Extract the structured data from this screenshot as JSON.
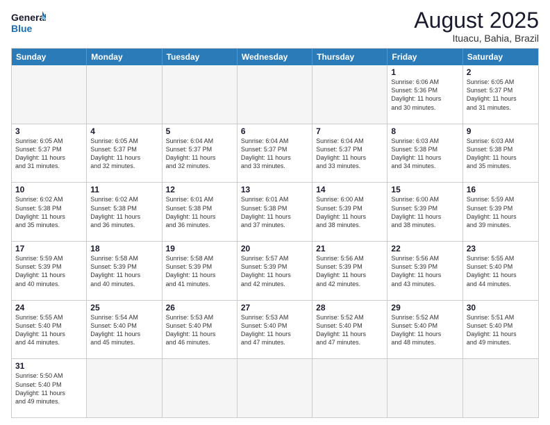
{
  "header": {
    "logo_general": "General",
    "logo_blue": "Blue",
    "main_title": "August 2025",
    "subtitle": "Ituacu, Bahia, Brazil"
  },
  "days_of_week": [
    "Sunday",
    "Monday",
    "Tuesday",
    "Wednesday",
    "Thursday",
    "Friday",
    "Saturday"
  ],
  "weeks": [
    [
      {
        "day": "",
        "sunrise": "",
        "sunset": "",
        "daylight": ""
      },
      {
        "day": "",
        "sunrise": "",
        "sunset": "",
        "daylight": ""
      },
      {
        "day": "",
        "sunrise": "",
        "sunset": "",
        "daylight": ""
      },
      {
        "day": "",
        "sunrise": "",
        "sunset": "",
        "daylight": ""
      },
      {
        "day": "",
        "sunrise": "",
        "sunset": "",
        "daylight": ""
      },
      {
        "day": "1",
        "sunrise": "Sunrise: 6:06 AM",
        "sunset": "Sunset: 5:36 PM",
        "daylight": "Daylight: 11 hours",
        "daylight2": "and 30 minutes."
      },
      {
        "day": "2",
        "sunrise": "Sunrise: 6:05 AM",
        "sunset": "Sunset: 5:37 PM",
        "daylight": "Daylight: 11 hours",
        "daylight2": "and 31 minutes."
      }
    ],
    [
      {
        "day": "3",
        "sunrise": "Sunrise: 6:05 AM",
        "sunset": "Sunset: 5:37 PM",
        "daylight": "Daylight: 11 hours",
        "daylight2": "and 31 minutes."
      },
      {
        "day": "4",
        "sunrise": "Sunrise: 6:05 AM",
        "sunset": "Sunset: 5:37 PM",
        "daylight": "Daylight: 11 hours",
        "daylight2": "and 32 minutes."
      },
      {
        "day": "5",
        "sunrise": "Sunrise: 6:04 AM",
        "sunset": "Sunset: 5:37 PM",
        "daylight": "Daylight: 11 hours",
        "daylight2": "and 32 minutes."
      },
      {
        "day": "6",
        "sunrise": "Sunrise: 6:04 AM",
        "sunset": "Sunset: 5:37 PM",
        "daylight": "Daylight: 11 hours",
        "daylight2": "and 33 minutes."
      },
      {
        "day": "7",
        "sunrise": "Sunrise: 6:04 AM",
        "sunset": "Sunset: 5:37 PM",
        "daylight": "Daylight: 11 hours",
        "daylight2": "and 33 minutes."
      },
      {
        "day": "8",
        "sunrise": "Sunrise: 6:03 AM",
        "sunset": "Sunset: 5:38 PM",
        "daylight": "Daylight: 11 hours",
        "daylight2": "and 34 minutes."
      },
      {
        "day": "9",
        "sunrise": "Sunrise: 6:03 AM",
        "sunset": "Sunset: 5:38 PM",
        "daylight": "Daylight: 11 hours",
        "daylight2": "and 35 minutes."
      }
    ],
    [
      {
        "day": "10",
        "sunrise": "Sunrise: 6:02 AM",
        "sunset": "Sunset: 5:38 PM",
        "daylight": "Daylight: 11 hours",
        "daylight2": "and 35 minutes."
      },
      {
        "day": "11",
        "sunrise": "Sunrise: 6:02 AM",
        "sunset": "Sunset: 5:38 PM",
        "daylight": "Daylight: 11 hours",
        "daylight2": "and 36 minutes."
      },
      {
        "day": "12",
        "sunrise": "Sunrise: 6:01 AM",
        "sunset": "Sunset: 5:38 PM",
        "daylight": "Daylight: 11 hours",
        "daylight2": "and 36 minutes."
      },
      {
        "day": "13",
        "sunrise": "Sunrise: 6:01 AM",
        "sunset": "Sunset: 5:38 PM",
        "daylight": "Daylight: 11 hours",
        "daylight2": "and 37 minutes."
      },
      {
        "day": "14",
        "sunrise": "Sunrise: 6:00 AM",
        "sunset": "Sunset: 5:39 PM",
        "daylight": "Daylight: 11 hours",
        "daylight2": "and 38 minutes."
      },
      {
        "day": "15",
        "sunrise": "Sunrise: 6:00 AM",
        "sunset": "Sunset: 5:39 PM",
        "daylight": "Daylight: 11 hours",
        "daylight2": "and 38 minutes."
      },
      {
        "day": "16",
        "sunrise": "Sunrise: 5:59 AM",
        "sunset": "Sunset: 5:39 PM",
        "daylight": "Daylight: 11 hours",
        "daylight2": "and 39 minutes."
      }
    ],
    [
      {
        "day": "17",
        "sunrise": "Sunrise: 5:59 AM",
        "sunset": "Sunset: 5:39 PM",
        "daylight": "Daylight: 11 hours",
        "daylight2": "and 40 minutes."
      },
      {
        "day": "18",
        "sunrise": "Sunrise: 5:58 AM",
        "sunset": "Sunset: 5:39 PM",
        "daylight": "Daylight: 11 hours",
        "daylight2": "and 40 minutes."
      },
      {
        "day": "19",
        "sunrise": "Sunrise: 5:58 AM",
        "sunset": "Sunset: 5:39 PM",
        "daylight": "Daylight: 11 hours",
        "daylight2": "and 41 minutes."
      },
      {
        "day": "20",
        "sunrise": "Sunrise: 5:57 AM",
        "sunset": "Sunset: 5:39 PM",
        "daylight": "Daylight: 11 hours",
        "daylight2": "and 42 minutes."
      },
      {
        "day": "21",
        "sunrise": "Sunrise: 5:56 AM",
        "sunset": "Sunset: 5:39 PM",
        "daylight": "Daylight: 11 hours",
        "daylight2": "and 42 minutes."
      },
      {
        "day": "22",
        "sunrise": "Sunrise: 5:56 AM",
        "sunset": "Sunset: 5:39 PM",
        "daylight": "Daylight: 11 hours",
        "daylight2": "and 43 minutes."
      },
      {
        "day": "23",
        "sunrise": "Sunrise: 5:55 AM",
        "sunset": "Sunset: 5:40 PM",
        "daylight": "Daylight: 11 hours",
        "daylight2": "and 44 minutes."
      }
    ],
    [
      {
        "day": "24",
        "sunrise": "Sunrise: 5:55 AM",
        "sunset": "Sunset: 5:40 PM",
        "daylight": "Daylight: 11 hours",
        "daylight2": "and 44 minutes."
      },
      {
        "day": "25",
        "sunrise": "Sunrise: 5:54 AM",
        "sunset": "Sunset: 5:40 PM",
        "daylight": "Daylight: 11 hours",
        "daylight2": "and 45 minutes."
      },
      {
        "day": "26",
        "sunrise": "Sunrise: 5:53 AM",
        "sunset": "Sunset: 5:40 PM",
        "daylight": "Daylight: 11 hours",
        "daylight2": "and 46 minutes."
      },
      {
        "day": "27",
        "sunrise": "Sunrise: 5:53 AM",
        "sunset": "Sunset: 5:40 PM",
        "daylight": "Daylight: 11 hours",
        "daylight2": "and 47 minutes."
      },
      {
        "day": "28",
        "sunrise": "Sunrise: 5:52 AM",
        "sunset": "Sunset: 5:40 PM",
        "daylight": "Daylight: 11 hours",
        "daylight2": "and 47 minutes."
      },
      {
        "day": "29",
        "sunrise": "Sunrise: 5:52 AM",
        "sunset": "Sunset: 5:40 PM",
        "daylight": "Daylight: 11 hours",
        "daylight2": "and 48 minutes."
      },
      {
        "day": "30",
        "sunrise": "Sunrise: 5:51 AM",
        "sunset": "Sunset: 5:40 PM",
        "daylight": "Daylight: 11 hours",
        "daylight2": "and 49 minutes."
      }
    ],
    [
      {
        "day": "31",
        "sunrise": "Sunrise: 5:50 AM",
        "sunset": "Sunset: 5:40 PM",
        "daylight": "Daylight: 11 hours",
        "daylight2": "and 49 minutes."
      },
      {
        "day": "",
        "sunrise": "",
        "sunset": "",
        "daylight": ""
      },
      {
        "day": "",
        "sunrise": "",
        "sunset": "",
        "daylight": ""
      },
      {
        "day": "",
        "sunrise": "",
        "sunset": "",
        "daylight": ""
      },
      {
        "day": "",
        "sunrise": "",
        "sunset": "",
        "daylight": ""
      },
      {
        "day": "",
        "sunrise": "",
        "sunset": "",
        "daylight": ""
      },
      {
        "day": "",
        "sunrise": "",
        "sunset": "",
        "daylight": ""
      }
    ]
  ]
}
